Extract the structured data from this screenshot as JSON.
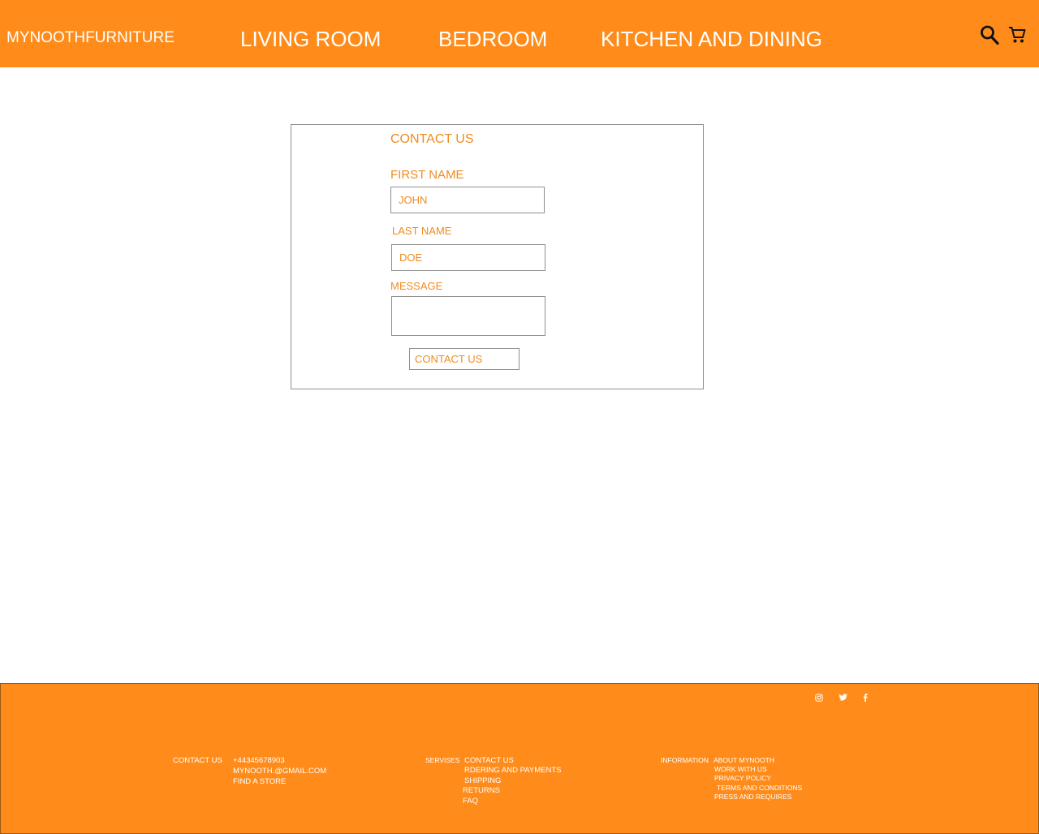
{
  "header": {
    "brand": "MYNOOTHFURNITURE",
    "nav": [
      "LIVING ROOM",
      "BEDROOM",
      "KITCHEN AND DINING"
    ],
    "icons": [
      "search-icon",
      "cart-icon"
    ]
  },
  "form": {
    "title": "CONTACT US",
    "first_name_label": "FIRST NAME",
    "first_name_value": "JOHN",
    "last_name_label": "LAST NAME",
    "last_name_value": "DOE",
    "message_label": "MESSAGE",
    "message_value": "",
    "submit_label": "CONTACT US"
  },
  "footer": {
    "contact": {
      "heading": "CONTACT US",
      "items": [
        "+44345678903",
        "MYNOOTH.@GMAIL.COM",
        "FIND A STORE"
      ]
    },
    "services": {
      "heading": "SERVISES",
      "items": [
        "CONTACT US",
        "RDERING AND PAYMENTS",
        "SHIPPING",
        "RETURNS",
        "FAQ"
      ]
    },
    "information": {
      "heading": "INFORMATION",
      "items": [
        "ABOUT MYNOOTH",
        "WORK WITH US",
        "PRIVACY POLICY",
        "TERMS AND CONDITIONS",
        "PRESS AND REQUIRES"
      ]
    },
    "social_icons": [
      "instagram-icon",
      "twitter-icon",
      "facebook-icon"
    ]
  },
  "colors": {
    "brand_orange": "#ff8c1a",
    "text_orange": "#f08c21",
    "border_gray": "#8f8f8f"
  }
}
